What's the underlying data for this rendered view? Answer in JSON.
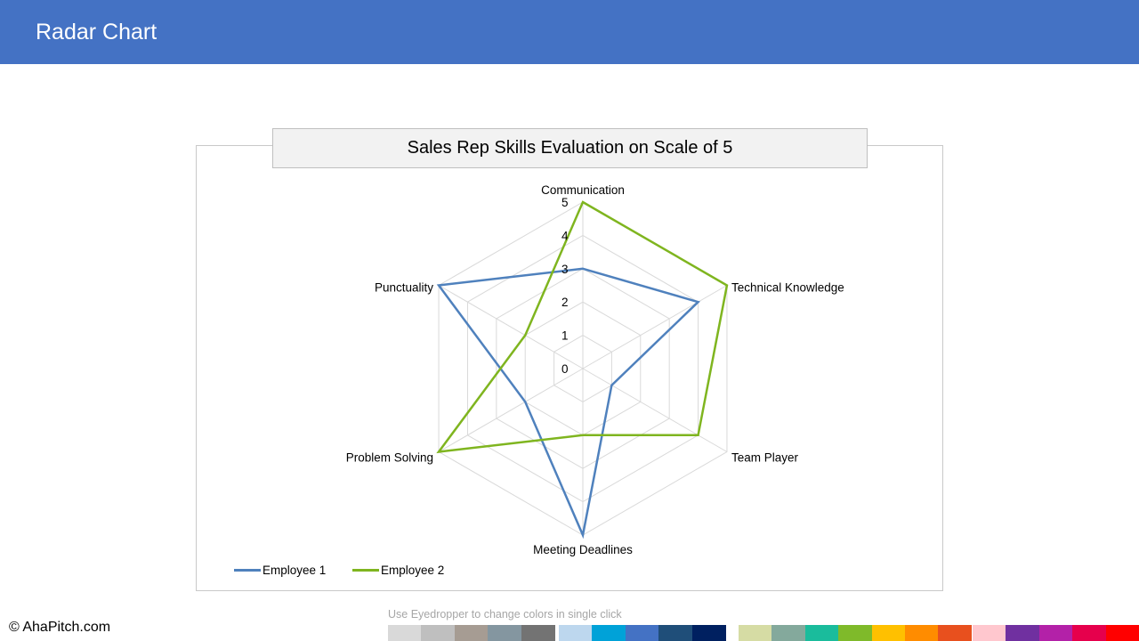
{
  "header": {
    "title": "Radar Chart"
  },
  "chart_data": {
    "type": "radar",
    "title": "Sales Rep Skills Evaluation on Scale of 5",
    "categories": [
      "Communication",
      "Technical Knowledge",
      "Team Player",
      "Meeting Deadlines",
      "Problem Solving",
      "Punctuality"
    ],
    "ticks": [
      "0",
      "1",
      "2",
      "3",
      "4",
      "5"
    ],
    "rmax": 5,
    "series": [
      {
        "name": "Employee 1",
        "color": "#4F81BD",
        "values": [
          3,
          4,
          1,
          5,
          2,
          5
        ]
      },
      {
        "name": "Employee 2",
        "color": "#7FB51F",
        "values": [
          5,
          5,
          4,
          2,
          5,
          2
        ]
      }
    ],
    "legend_position": "bottom-left"
  },
  "footer": {
    "copyright": "© AhaPitch.com",
    "eyedropper_hint": "Use Eyedropper to change colors in single click",
    "palette": [
      "#D9D9D9",
      "#BFBFBF",
      "#A69C93",
      "#8496A0",
      "#737373",
      "#BDD7EE",
      "#00A2D8",
      "#4472C4",
      "#1F4E79",
      "#002060",
      "#D6DCA4",
      "#84A99C",
      "#1ABC9C",
      "#7FBA2A",
      "#FFC000",
      "#FF8C00",
      "#E8501E",
      "#FFC7CE",
      "#7030A0",
      "#B321A8",
      "#E6004C",
      "#FF0000"
    ]
  }
}
